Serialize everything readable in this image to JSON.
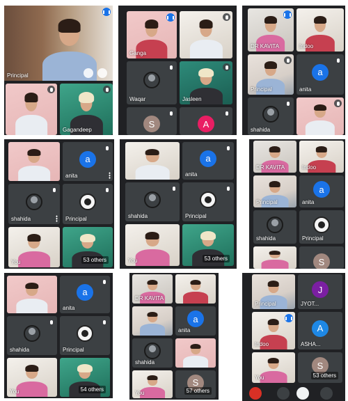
{
  "names": {
    "principal": "Principal",
    "gagandeep": "Gagandeep",
    "ganga": "Ganga",
    "waqar": "Waqar",
    "jasleen": "Jasleen",
    "kavita": "DR KAVITA",
    "indoo": "Indoo",
    "anita": "anita",
    "shahida": "shahida",
    "you": "You",
    "jaideep": "Jaideep",
    "jyoti": "JYOT...",
    "asha": "ASHA..."
  },
  "avatars": {
    "a": "a",
    "s": "S",
    "A": "A",
    "j": "J"
  },
  "others": {
    "o53": "53 others",
    "o54": "54 others",
    "o57": "57 others"
  },
  "colors": {
    "anita_avatar": "#1a73e8",
    "s_avatar": "#a1887f",
    "A_avatar": "#e91e63",
    "jyoti_avatar": "#7b1fa2",
    "asha_avatar": "#1e88e5",
    "speaking_indicator": "#1a73e8",
    "call_background": "#202124"
  }
}
